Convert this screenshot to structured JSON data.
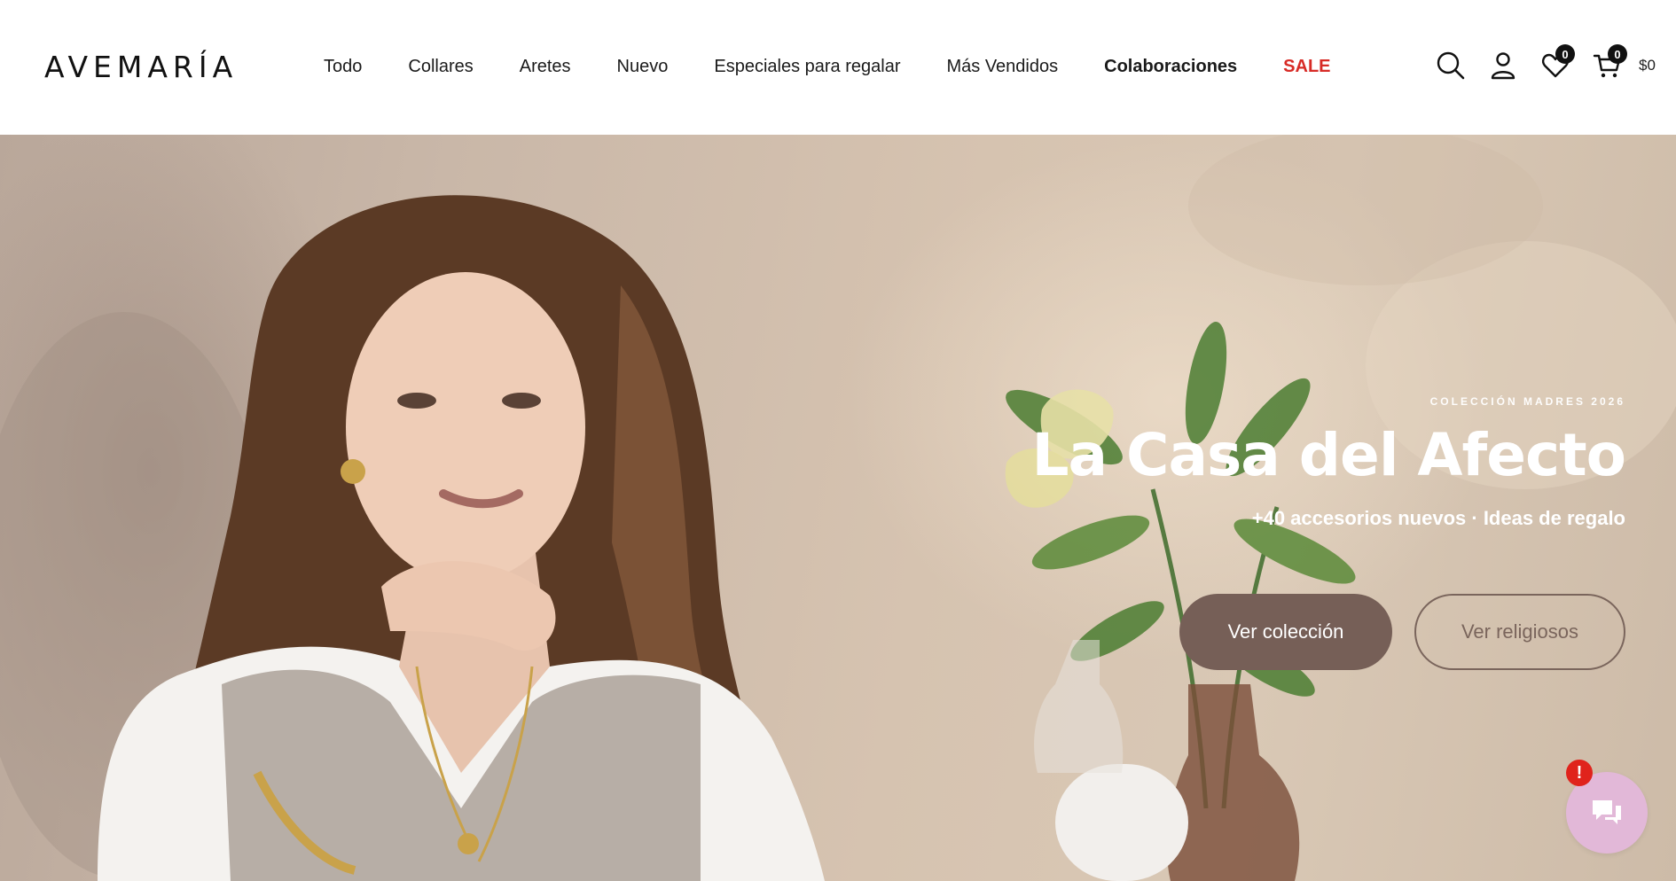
{
  "brand": {
    "logo_text": "AVEMARÍA"
  },
  "nav": {
    "items": [
      {
        "label": "Todo"
      },
      {
        "label": "Collares"
      },
      {
        "label": "Aretes"
      },
      {
        "label": "Nuevo"
      },
      {
        "label": "Especiales para regalar"
      },
      {
        "label": "Más Vendidos"
      },
      {
        "label": "Colaboraciones"
      },
      {
        "label": "SALE"
      }
    ]
  },
  "header_icons": {
    "search": "search-icon",
    "account": "user-icon",
    "wishlist": {
      "icon": "heart-icon",
      "count": "0"
    },
    "cart": {
      "icon": "cart-icon",
      "count": "0",
      "total": "$0"
    }
  },
  "hero": {
    "eyebrow": "COLECCIÓN MADRES 2026",
    "title": "La Casa del Afecto",
    "subtitle": "+40 accesorios nuevos · Ideas de regalo",
    "primary_button": "Ver colección",
    "secondary_button": "Ver religiosos"
  },
  "chat_widget": {
    "icon": "chat-icon",
    "alert": "!"
  },
  "colors": {
    "sale": "#d72b26",
    "primary_button": "#765f57",
    "chat_bubble": "#e2b8d8",
    "alert": "#e0231c"
  }
}
